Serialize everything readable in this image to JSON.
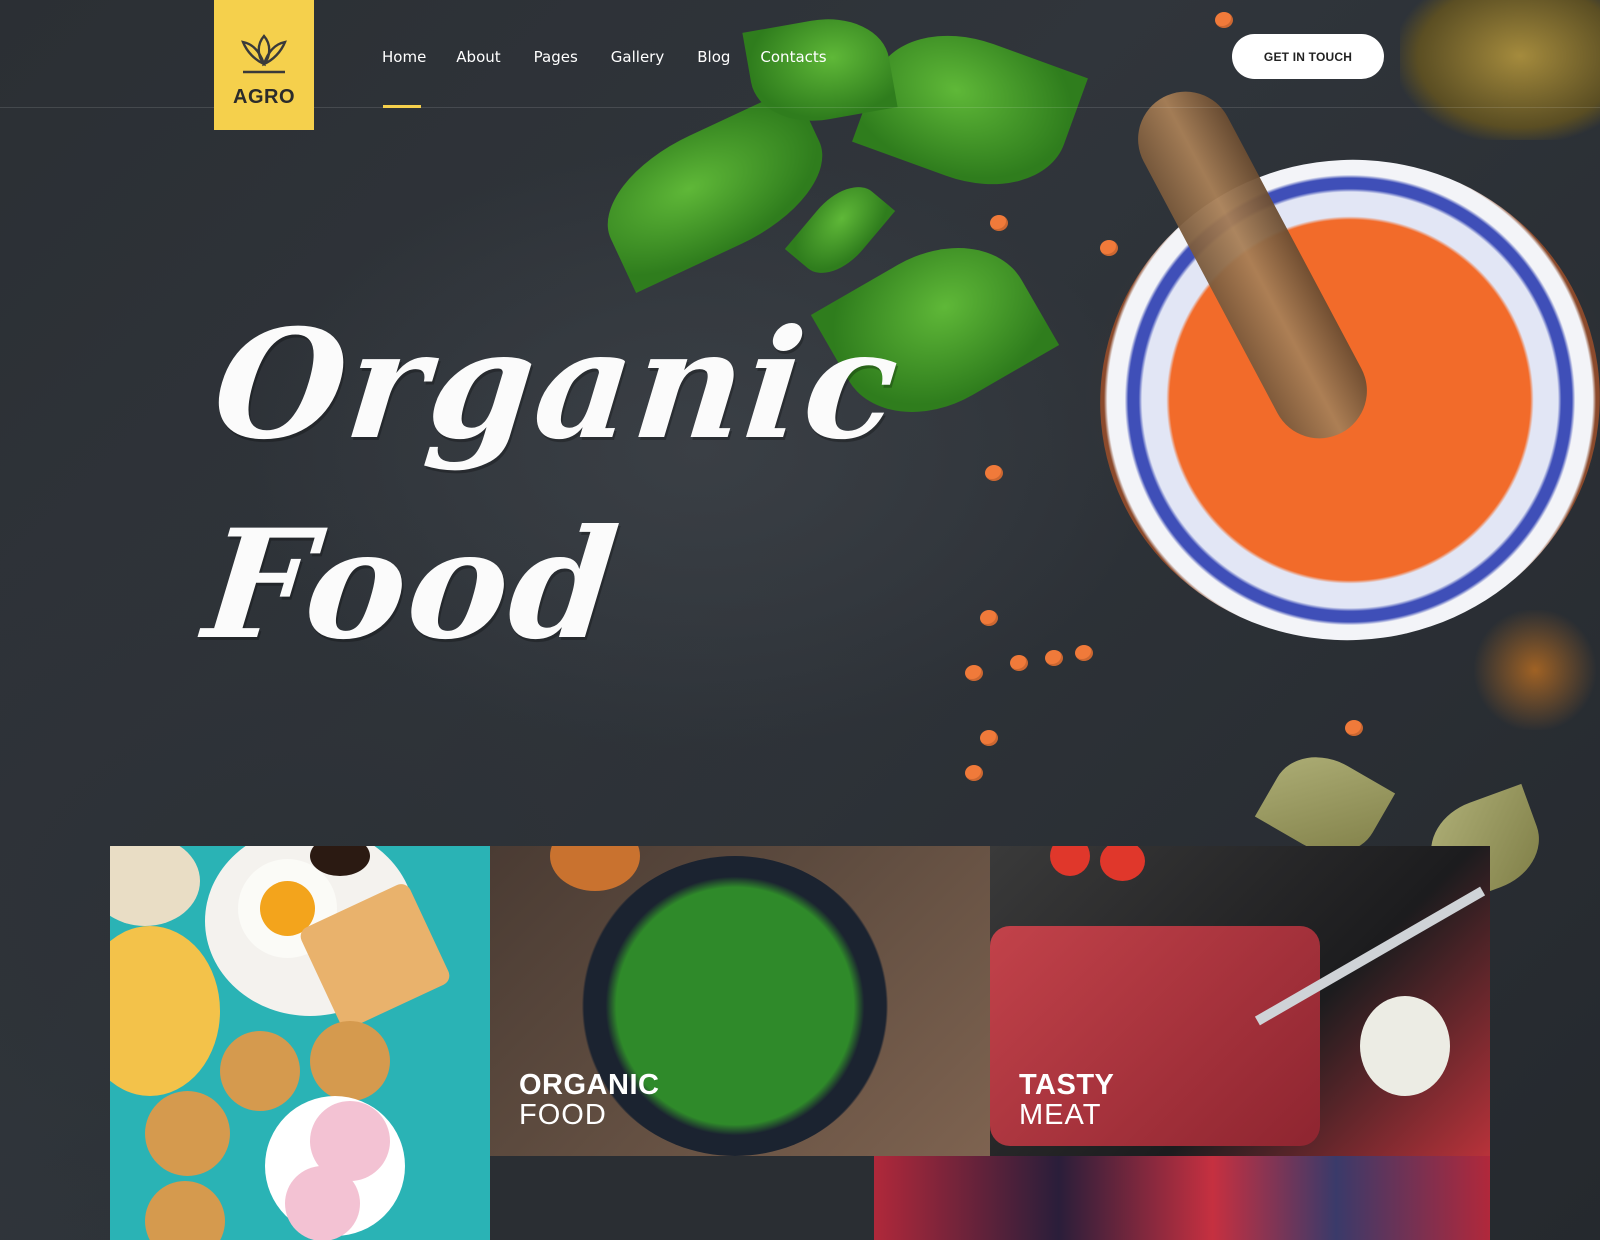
{
  "brand": {
    "name": "AGRO",
    "accent": "#f5d04c"
  },
  "nav": {
    "items": [
      {
        "label": "Home",
        "active": true
      },
      {
        "label": "About"
      },
      {
        "label": "Pages"
      },
      {
        "label": "Gallery"
      },
      {
        "label": "Blog"
      },
      {
        "label": "Contacts"
      }
    ]
  },
  "header": {
    "cta_label": "GET IN TOUCH"
  },
  "hero": {
    "line1": "Organic",
    "line2": "Food"
  },
  "tiles": {
    "organic": {
      "line1": "ORGANIC",
      "line2": "FOOD"
    },
    "meat": {
      "line1": "TASTY",
      "line2": "MEAT"
    }
  }
}
